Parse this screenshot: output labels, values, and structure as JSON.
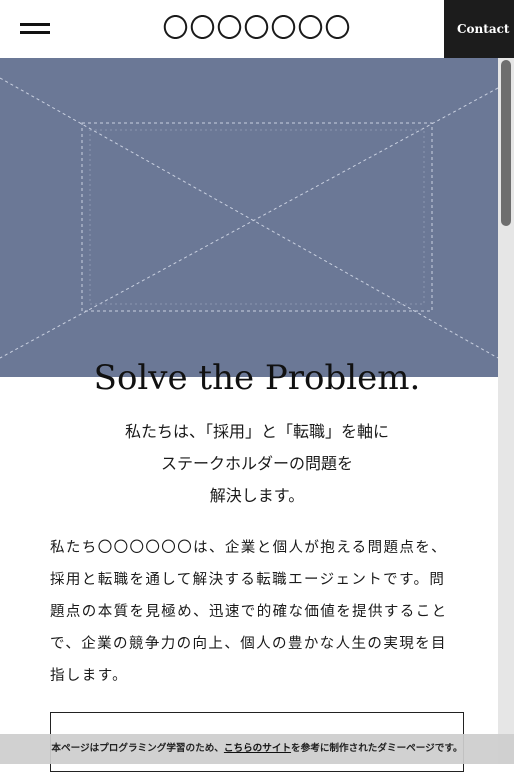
{
  "header": {
    "logo_text": "〇〇〇〇〇〇〇",
    "contact_label": "Contact"
  },
  "hero": {
    "image": "placeholder-image",
    "background_color": "#6b7896"
  },
  "main": {
    "title": "Solve the Problem.",
    "lead_lines": [
      "私たちは、「採用」と「転職」を軸に",
      "ステークホルダーの問題を",
      "解決します。"
    ],
    "body": "私たち〇〇〇〇〇〇は、企業と個人が抱える問題点を、採用と転職を通して解決する転職エージェントです。問題点の本質を見極め、迅速で的確な価値を提供することで、企業の競争力の向上、個人の豊かな人生の実現を目指します。"
  },
  "notice": {
    "prefix": "本ページはプログラミング学習のため、",
    "link": "こちらのサイト",
    "suffix": "を参考に制作されたダミーページです。"
  }
}
